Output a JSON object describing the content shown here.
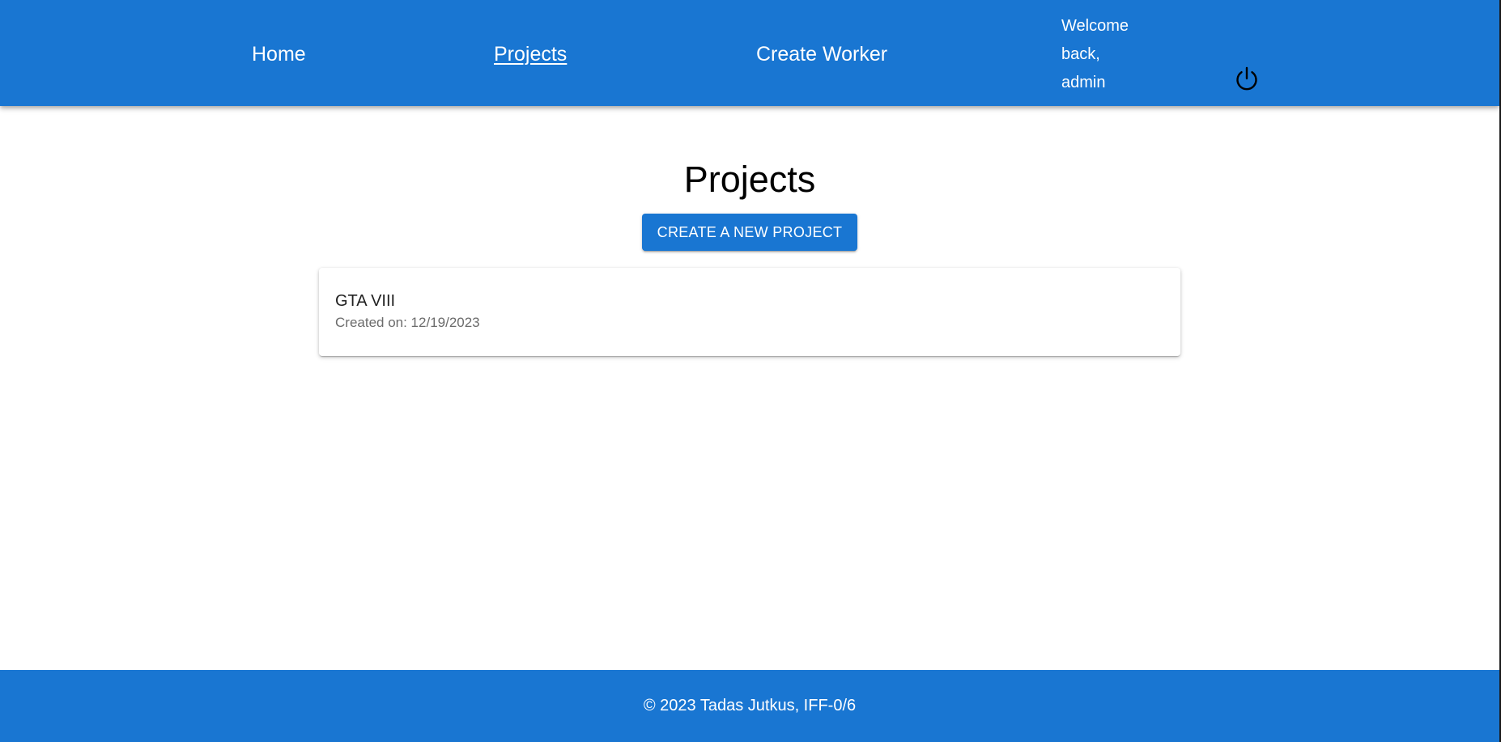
{
  "header": {
    "nav": {
      "home": "Home",
      "projects": "Projects",
      "create_worker": "Create Worker"
    },
    "welcome": {
      "line1": "Welcome",
      "line2": "back,",
      "line3": "admin"
    },
    "logout_icon": "power-icon"
  },
  "main": {
    "title": "Projects",
    "create_button": "CREATE A NEW PROJECT",
    "projects": [
      {
        "name": "GTA VIII",
        "created": "Created on: 12/19/2023"
      }
    ]
  },
  "footer": {
    "text": "© 2023 Tadas Jutkus, IFF-0/6"
  },
  "colors": {
    "primary": "#1976d2",
    "background": "#ffffff",
    "text_dark": "#212121",
    "text_muted": "#6b6b6b"
  }
}
